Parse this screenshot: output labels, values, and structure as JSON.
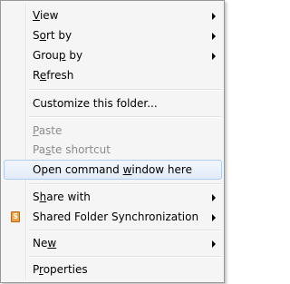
{
  "menu": {
    "items": [
      {
        "label": "View",
        "key": "V",
        "submenu": true
      },
      {
        "label": "Sort by",
        "key": "o",
        "submenu": true
      },
      {
        "label": "Group by",
        "key": "p",
        "submenu": true
      },
      {
        "label": "Refresh",
        "key": "e",
        "submenu": false
      },
      {
        "label": "Customize this folder...",
        "key": "F",
        "submenu": false
      },
      {
        "label": "Paste",
        "key": "P",
        "disabled": true
      },
      {
        "label": "Paste shortcut",
        "key": "s",
        "disabled": true
      },
      {
        "label": "Open command window here",
        "key": "w",
        "highlighted": true
      },
      {
        "label": "Share with",
        "key": "h",
        "submenu": true
      },
      {
        "label": "Shared Folder Synchronization",
        "submenu": true,
        "icon": "shared-folder-sync-icon"
      },
      {
        "label": "New",
        "key": "w",
        "submenu": true
      },
      {
        "label": "Properties",
        "key": "r",
        "submenu": false
      }
    ],
    "sync_icon_glyph": "S",
    "colors": {
      "background": "#f5f5f5",
      "highlight_border": "#aecdf0",
      "disabled_text": "#8b8b8b",
      "sync_icon": "#f0a33a"
    }
  }
}
